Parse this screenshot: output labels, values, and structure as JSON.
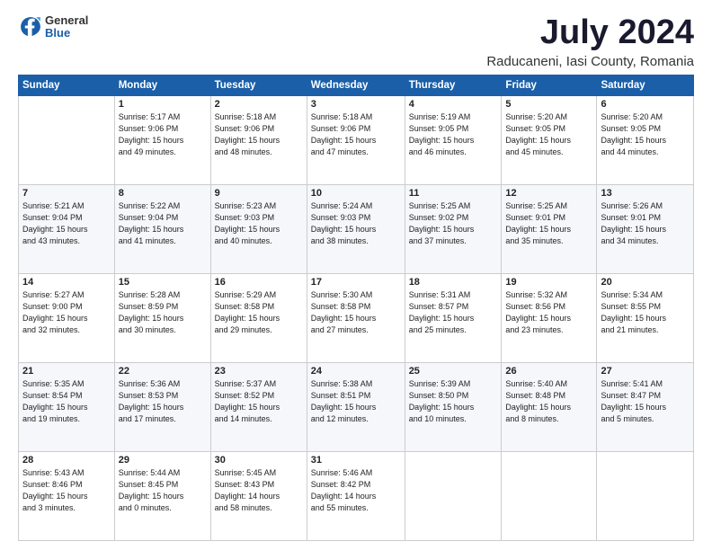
{
  "logo": {
    "general": "General",
    "blue": "Blue"
  },
  "header": {
    "month_year": "July 2024",
    "location": "Raducaneni, Iasi County, Romania"
  },
  "days_of_week": [
    "Sunday",
    "Monday",
    "Tuesday",
    "Wednesday",
    "Thursday",
    "Friday",
    "Saturday"
  ],
  "weeks": [
    [
      {
        "day": "",
        "info": ""
      },
      {
        "day": "1",
        "info": "Sunrise: 5:17 AM\nSunset: 9:06 PM\nDaylight: 15 hours\nand 49 minutes."
      },
      {
        "day": "2",
        "info": "Sunrise: 5:18 AM\nSunset: 9:06 PM\nDaylight: 15 hours\nand 48 minutes."
      },
      {
        "day": "3",
        "info": "Sunrise: 5:18 AM\nSunset: 9:06 PM\nDaylight: 15 hours\nand 47 minutes."
      },
      {
        "day": "4",
        "info": "Sunrise: 5:19 AM\nSunset: 9:05 PM\nDaylight: 15 hours\nand 46 minutes."
      },
      {
        "day": "5",
        "info": "Sunrise: 5:20 AM\nSunset: 9:05 PM\nDaylight: 15 hours\nand 45 minutes."
      },
      {
        "day": "6",
        "info": "Sunrise: 5:20 AM\nSunset: 9:05 PM\nDaylight: 15 hours\nand 44 minutes."
      }
    ],
    [
      {
        "day": "7",
        "info": "Sunrise: 5:21 AM\nSunset: 9:04 PM\nDaylight: 15 hours\nand 43 minutes."
      },
      {
        "day": "8",
        "info": "Sunrise: 5:22 AM\nSunset: 9:04 PM\nDaylight: 15 hours\nand 41 minutes."
      },
      {
        "day": "9",
        "info": "Sunrise: 5:23 AM\nSunset: 9:03 PM\nDaylight: 15 hours\nand 40 minutes."
      },
      {
        "day": "10",
        "info": "Sunrise: 5:24 AM\nSunset: 9:03 PM\nDaylight: 15 hours\nand 38 minutes."
      },
      {
        "day": "11",
        "info": "Sunrise: 5:25 AM\nSunset: 9:02 PM\nDaylight: 15 hours\nand 37 minutes."
      },
      {
        "day": "12",
        "info": "Sunrise: 5:25 AM\nSunset: 9:01 PM\nDaylight: 15 hours\nand 35 minutes."
      },
      {
        "day": "13",
        "info": "Sunrise: 5:26 AM\nSunset: 9:01 PM\nDaylight: 15 hours\nand 34 minutes."
      }
    ],
    [
      {
        "day": "14",
        "info": "Sunrise: 5:27 AM\nSunset: 9:00 PM\nDaylight: 15 hours\nand 32 minutes."
      },
      {
        "day": "15",
        "info": "Sunrise: 5:28 AM\nSunset: 8:59 PM\nDaylight: 15 hours\nand 30 minutes."
      },
      {
        "day": "16",
        "info": "Sunrise: 5:29 AM\nSunset: 8:58 PM\nDaylight: 15 hours\nand 29 minutes."
      },
      {
        "day": "17",
        "info": "Sunrise: 5:30 AM\nSunset: 8:58 PM\nDaylight: 15 hours\nand 27 minutes."
      },
      {
        "day": "18",
        "info": "Sunrise: 5:31 AM\nSunset: 8:57 PM\nDaylight: 15 hours\nand 25 minutes."
      },
      {
        "day": "19",
        "info": "Sunrise: 5:32 AM\nSunset: 8:56 PM\nDaylight: 15 hours\nand 23 minutes."
      },
      {
        "day": "20",
        "info": "Sunrise: 5:34 AM\nSunset: 8:55 PM\nDaylight: 15 hours\nand 21 minutes."
      }
    ],
    [
      {
        "day": "21",
        "info": "Sunrise: 5:35 AM\nSunset: 8:54 PM\nDaylight: 15 hours\nand 19 minutes."
      },
      {
        "day": "22",
        "info": "Sunrise: 5:36 AM\nSunset: 8:53 PM\nDaylight: 15 hours\nand 17 minutes."
      },
      {
        "day": "23",
        "info": "Sunrise: 5:37 AM\nSunset: 8:52 PM\nDaylight: 15 hours\nand 14 minutes."
      },
      {
        "day": "24",
        "info": "Sunrise: 5:38 AM\nSunset: 8:51 PM\nDaylight: 15 hours\nand 12 minutes."
      },
      {
        "day": "25",
        "info": "Sunrise: 5:39 AM\nSunset: 8:50 PM\nDaylight: 15 hours\nand 10 minutes."
      },
      {
        "day": "26",
        "info": "Sunrise: 5:40 AM\nSunset: 8:48 PM\nDaylight: 15 hours\nand 8 minutes."
      },
      {
        "day": "27",
        "info": "Sunrise: 5:41 AM\nSunset: 8:47 PM\nDaylight: 15 hours\nand 5 minutes."
      }
    ],
    [
      {
        "day": "28",
        "info": "Sunrise: 5:43 AM\nSunset: 8:46 PM\nDaylight: 15 hours\nand 3 minutes."
      },
      {
        "day": "29",
        "info": "Sunrise: 5:44 AM\nSunset: 8:45 PM\nDaylight: 15 hours\nand 0 minutes."
      },
      {
        "day": "30",
        "info": "Sunrise: 5:45 AM\nSunset: 8:43 PM\nDaylight: 14 hours\nand 58 minutes."
      },
      {
        "day": "31",
        "info": "Sunrise: 5:46 AM\nSunset: 8:42 PM\nDaylight: 14 hours\nand 55 minutes."
      },
      {
        "day": "",
        "info": ""
      },
      {
        "day": "",
        "info": ""
      },
      {
        "day": "",
        "info": ""
      }
    ]
  ]
}
